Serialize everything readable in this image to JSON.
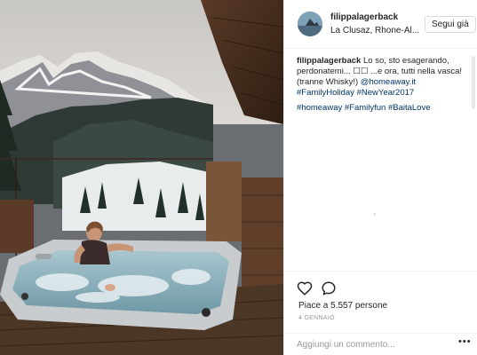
{
  "post": {
    "username": "filippalagerback",
    "location": "La Clusaz, Rhone-Al...",
    "follow_label": "Segui già"
  },
  "caption": {
    "username": "filippalagerback",
    "text": "Lo so, sto esagerando, perdonatemi... ☐☐ ...e ora, tutti nella vasca! (tranne Whisky!)",
    "mention": "@homeaway.it",
    "hashtags_line1": "#FamilyHoliday #NewYear2017",
    "hashtags_line2": "#homeaway #Familyfun #BaitaLove",
    "loading": "◦"
  },
  "actions": {
    "like_icon": "heart-icon",
    "comment_icon": "comment-icon",
    "likes_text": "Piace a 5.557 persone",
    "date": "4 GENNAIO"
  },
  "comment_box": {
    "placeholder": "Aggiungi un commento...",
    "more_label": "•••"
  },
  "colors": {
    "link": "#003569",
    "border": "#efefef",
    "muted": "#999999"
  }
}
